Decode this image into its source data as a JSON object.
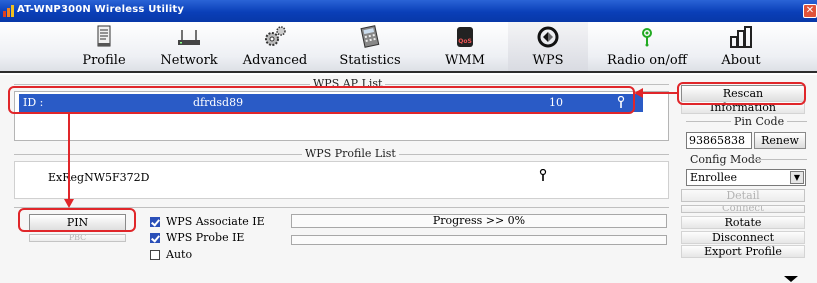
{
  "window": {
    "title": "AT-WNP300N Wireless Utility",
    "close_symbol": "✕"
  },
  "toolbar": {
    "items": [
      {
        "label": "Profile",
        "icon": "profile-icon"
      },
      {
        "label": "Network",
        "icon": "network-icon"
      },
      {
        "label": "Advanced",
        "icon": "advanced-icon"
      },
      {
        "label": "Statistics",
        "icon": "statistics-icon"
      },
      {
        "label": "WMM",
        "icon": "wmm-icon"
      },
      {
        "label": "WPS",
        "icon": "wps-icon"
      },
      {
        "label": "Radio on/off",
        "icon": "radio-icon"
      },
      {
        "label": "About",
        "icon": "about-icon"
      }
    ],
    "active": "WPS"
  },
  "wps_ap_list": {
    "title": "WPS AP List",
    "rows": [
      {
        "id_label": "ID :",
        "ssid": "dfrdsd89",
        "channel": "10"
      }
    ]
  },
  "wps_profile_list": {
    "title": "WPS Profile List",
    "rows": [
      {
        "name": "ExRegNW5F372D"
      }
    ]
  },
  "buttons": {
    "pin": "PIN",
    "pbc": "PBC",
    "rescan": "Rescan",
    "information": "Information",
    "renew": "Renew",
    "detail": "Detail",
    "connect": "Connect",
    "rotate": "Rotate",
    "disconnect": "Disconnect",
    "export_profile": "Export Profile"
  },
  "options": {
    "associate_ie": {
      "label": "WPS Associate IE",
      "checked": true
    },
    "probe_ie": {
      "label": "WPS Probe IE",
      "checked": true
    },
    "auto": {
      "label": "Auto",
      "checked": false
    }
  },
  "progress": {
    "text": "Progress >> 0%",
    "value": 0
  },
  "pin_code": {
    "label": "Pin Code",
    "value": "93865838"
  },
  "config_mode": {
    "label": "Config Mode",
    "selected": "Enrollee"
  },
  "colors": {
    "highlight": "#e0262a",
    "selection": "#2a5bc6",
    "titlebar": "#0a3fb8"
  }
}
